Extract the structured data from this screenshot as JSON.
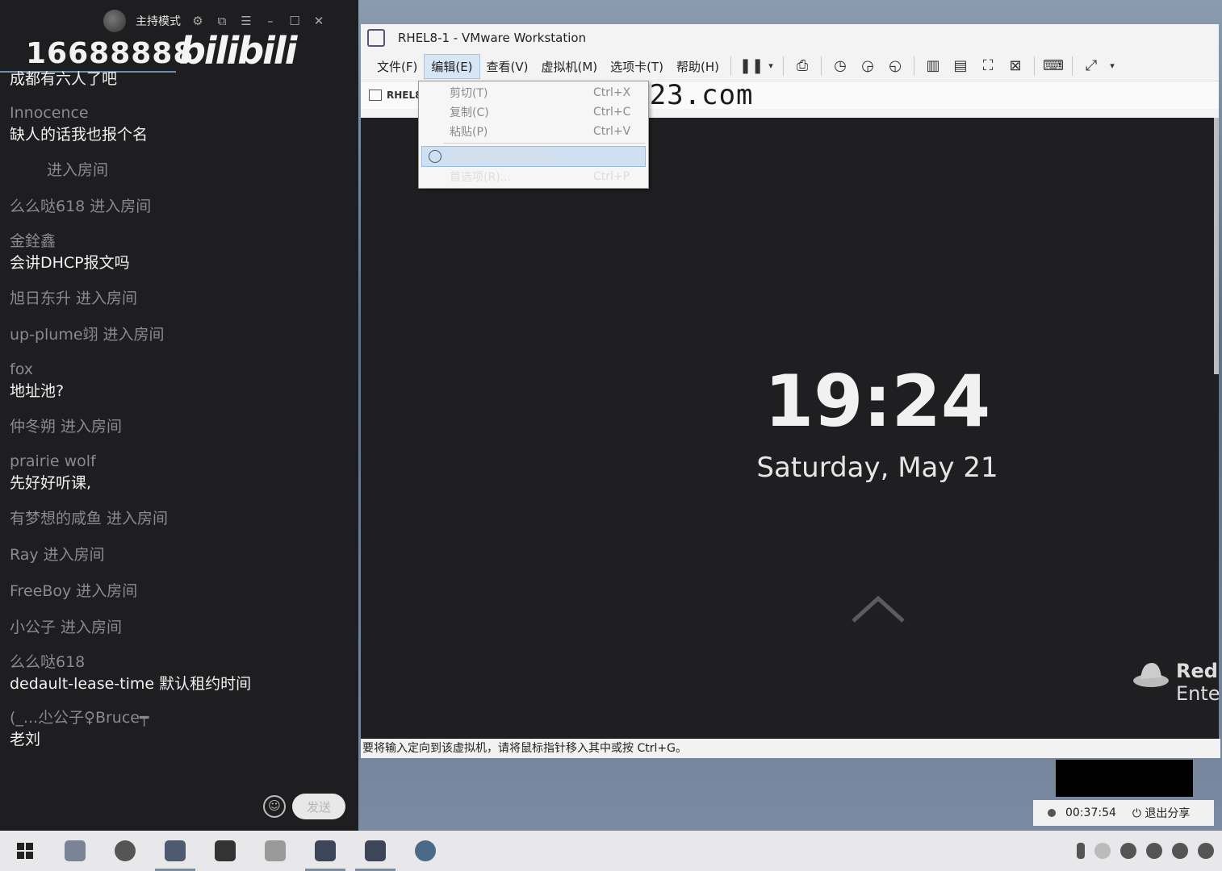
{
  "chat": {
    "host_mode": "主持模式",
    "room_number": "16688888",
    "logo_text": "bilibili",
    "messages": [
      {
        "kind": "chat",
        "user": "",
        "text": "成都有六人了吧"
      },
      {
        "kind": "chat",
        "user": "Innocence",
        "text": "缺人的话我也报个名"
      },
      {
        "kind": "enter",
        "user": "",
        "verb": "进入房间"
      },
      {
        "kind": "enter",
        "user": "么么哒618",
        "verb": "进入房间"
      },
      {
        "kind": "chat",
        "user": "金銓鑫",
        "text": "会讲DHCP报文吗"
      },
      {
        "kind": "enter",
        "user": "旭日东升",
        "verb": "进入房间"
      },
      {
        "kind": "enter",
        "user": "up-plume翊",
        "verb": "进入房间"
      },
      {
        "kind": "chat",
        "user": "fox",
        "text": "地址池?"
      },
      {
        "kind": "enter",
        "user": "仲冬朔",
        "verb": "进入房间"
      },
      {
        "kind": "chat",
        "user": "prairie wolf",
        "text": "先好好听课,"
      },
      {
        "kind": "enter",
        "user": "有梦想的咸鱼",
        "verb": "进入房间"
      },
      {
        "kind": "enter",
        "user": "Ray",
        "verb": "进入房间"
      },
      {
        "kind": "enter",
        "user": "FreeBoy",
        "verb": "进入房间"
      },
      {
        "kind": "enter",
        "user": "小公子",
        "verb": "进入房间"
      },
      {
        "kind": "chat",
        "user": "么么哒618",
        "text": "dedault-lease-time 默认租约时间"
      },
      {
        "kind": "chat",
        "user": "(_...尐公子♀Bruce┯",
        "text": "老刘"
      }
    ],
    "send_label": "发送"
  },
  "vmware": {
    "title": "RHEL8-1 - VMware Workstation",
    "menus": [
      "文件(F)",
      "编辑(E)",
      "查看(V)",
      "虚拟机(M)",
      "选项卡(T)",
      "帮助(H)"
    ],
    "tab_label": "RHEL8",
    "watermark": "www.heike123.com",
    "edit_menu": [
      {
        "label": "剪切(T)",
        "shortcut": "Ctrl+X",
        "disabled": true
      },
      {
        "label": "复制(C)",
        "shortcut": "Ctrl+C",
        "disabled": true
      },
      {
        "label": "粘贴(P)",
        "shortcut": "Ctrl+V",
        "disabled": true
      },
      {
        "label": "虚拟网络编辑器(N)...",
        "shortcut": "",
        "disabled": false,
        "highlighted": true
      },
      {
        "label": "首选项(R)...",
        "shortcut": "Ctrl+P",
        "disabled": false
      }
    ],
    "guest": {
      "clock": "19:24",
      "date": "Saturday, May 21",
      "brand_line1": "Red",
      "brand_line2": "Ente"
    },
    "status_text": "要将输入定向到该虚拟机，请将鼠标指针移入其中或按 Ctrl+G。"
  },
  "recording": {
    "elapsed": "00:37:54",
    "stop_label": "退出分享"
  },
  "colors": {
    "accent": "#7a8ea8",
    "menu_highlight": "#cfe0f2"
  }
}
